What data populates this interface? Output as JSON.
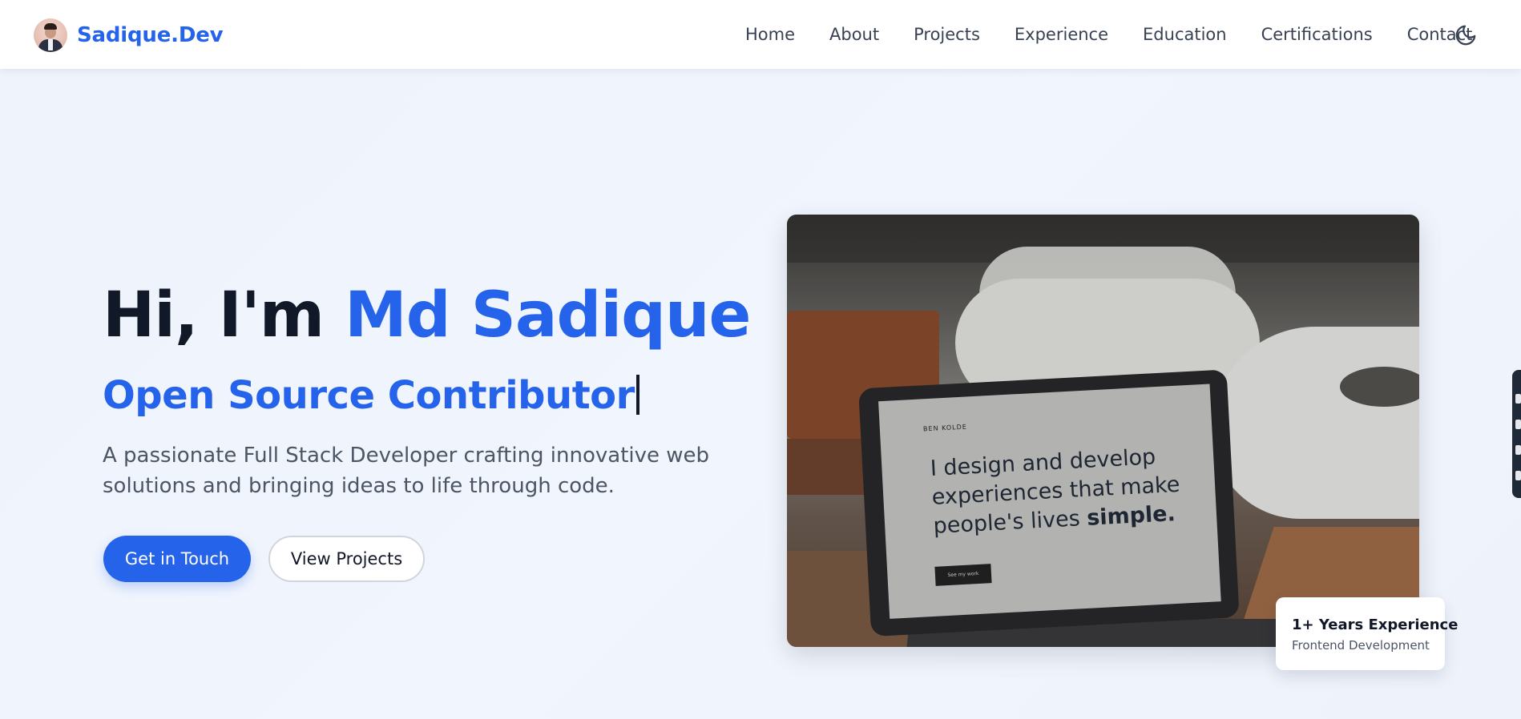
{
  "brand": {
    "name": "Sadique.Dev",
    "avatar_icon": "profile-photo"
  },
  "nav": {
    "items": [
      {
        "label": "Home"
      },
      {
        "label": "About"
      },
      {
        "label": "Projects"
      },
      {
        "label": "Experience"
      },
      {
        "label": "Education"
      },
      {
        "label": "Certifications"
      },
      {
        "label": "Contact"
      }
    ],
    "theme_toggle_icon": "moon-icon"
  },
  "hero": {
    "greeting": "Hi, I'm ",
    "name": "Md Sadique",
    "role": "Open Source Contributor",
    "description": "A passionate Full Stack Developer crafting innovative web solutions and bringing ideas to life through code.",
    "primary_button": "Get in Touch",
    "secondary_button": "View Projects"
  },
  "hero_image": {
    "screen_brand": "BEN KOLDE",
    "screen_text_line1": "I design and develop",
    "screen_text_line2": "experiences that make",
    "screen_text_line3": "people's lives ",
    "screen_text_bold": "simple.",
    "screen_button": "See my work"
  },
  "experience_badge": {
    "title": "1+ Years Experience",
    "subtitle": "Frontend Development"
  },
  "colors": {
    "accent": "#2563eb",
    "heading": "#111827",
    "body_text": "#4b5563",
    "background": "#eef3fc"
  }
}
